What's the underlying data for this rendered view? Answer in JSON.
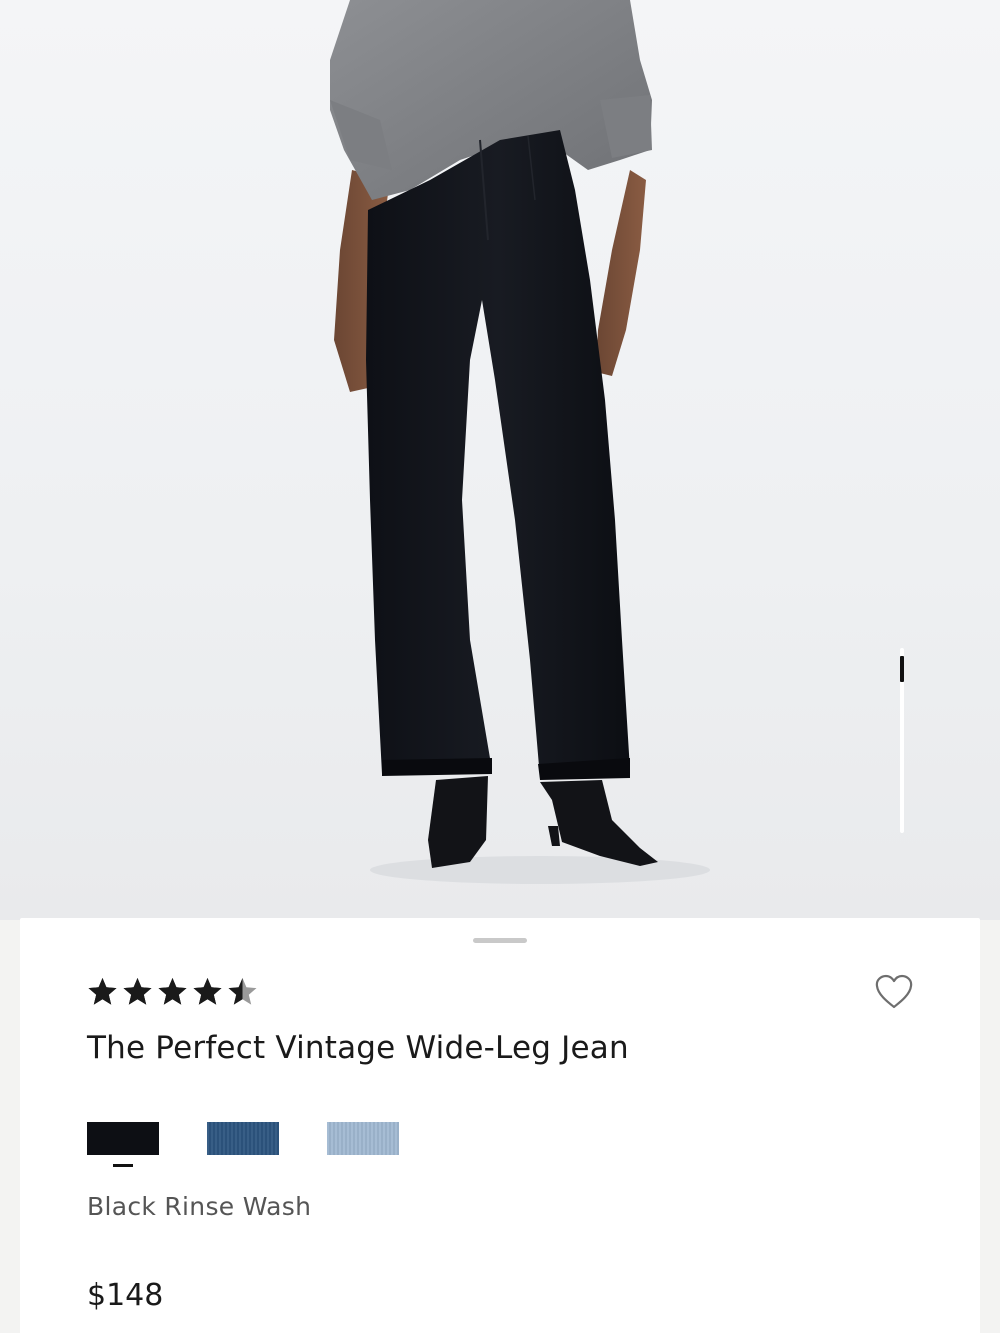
{
  "product_image": {
    "alt_label": "",
    "gallery_position": 0.05
  },
  "product": {
    "rating": 4.5,
    "rating_max": 5,
    "title": "The Perfect Vintage Wide-Leg Jean",
    "selected_color": "Black Rinse Wash",
    "price": "$148",
    "colors": [
      {
        "name": "Black Rinse Wash",
        "hex": "#0d0f14",
        "selected": true
      },
      {
        "name": "",
        "hex": "#2d5580",
        "selected": false
      },
      {
        "name": "",
        "hex": "#9fb7d0",
        "selected": false
      }
    ]
  },
  "icons": {
    "rating_star": "star-icon",
    "wishlist": "heart-outline-icon"
  },
  "colors": {
    "text_primary": "#1a1a1a",
    "text_secondary": "#555555",
    "star": "#1a1a1a",
    "sheet_bg": "#ffffff"
  }
}
